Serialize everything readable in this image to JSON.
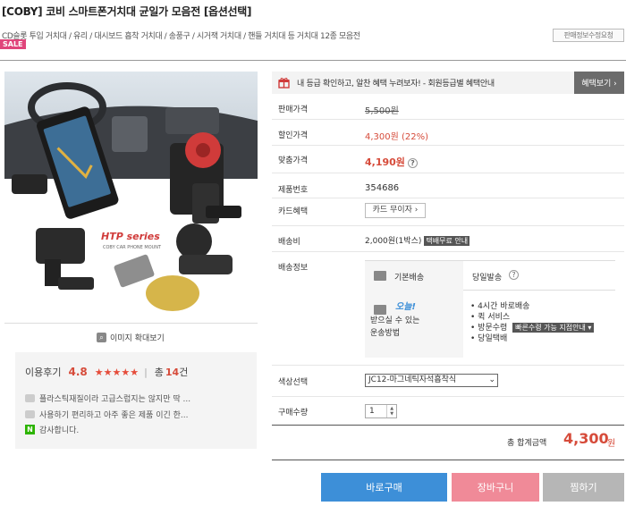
{
  "header": {
    "title": "[COBY] 코비 스마트폰거치대 균일가 모음전 [옵션선택]",
    "subtitle": "CD슬롯 투입 거치대 / 유리 / 대시보드 흡착 거치대 / 송풍구 / 시거잭 거치대 / 핸들 거치대 등 거치대 12종 모음전",
    "sale_badge": "SALE",
    "seller_info": "판매정보수정요청"
  },
  "image": {
    "brand_text": "HTP series",
    "brand_sub": "COBY CAR PHONE MOUNT",
    "zoom_label": "이미지 확대보기"
  },
  "reviews": {
    "label": "이용후기",
    "score": "4.8",
    "stars": "★★★★★",
    "count_label": "총",
    "count": "14",
    "count_unit": "건",
    "items": [
      "플라스틱재질이라 고급스럽지는 않지만 딱 ...",
      "사용하기 편리하고 아주 좋은 제품 이긴 한...",
      "감사합니다."
    ]
  },
  "promo": {
    "text": "내 등급 확인하고, 알찬 혜택 누려보자! - 회원등급별 혜택안내",
    "button": "혜택보기 ›"
  },
  "price": {
    "sale_label": "판매가격",
    "sale_value": "5,500원",
    "discount_label": "할인가격",
    "discount_value": "4,300원 (22%)",
    "custom_label": "맞춤가격",
    "custom_value": "4,190원",
    "product_no_label": "제품번호",
    "product_no": "354686",
    "card_label": "카드혜택",
    "card_button": "카드 무이자 ›",
    "ship_fee_label": "배송비",
    "ship_fee_value": "2,000원(1박스)",
    "free_ship_badge": "택배무료 안내",
    "ship_info_label": "배송정보"
  },
  "shipping": {
    "basic_label": "기본배송",
    "basic_value": "당일발송",
    "today_label": "오늘!",
    "today_sub1": "받으실 수 있는",
    "today_sub2": "운송방법",
    "methods": [
      "4시간 바로배송",
      "퀵 서비스",
      "방문수령",
      "당일택배"
    ],
    "pickup_badge": "빠른수령 가능 지점안내 ▾"
  },
  "options": {
    "color_label": "색상선택",
    "color_value": "JC12-마그네틱자석흡착식",
    "qty_label": "구매수량",
    "qty_value": "1"
  },
  "total": {
    "label": "총 합계금액",
    "value": "4,300",
    "unit": "원"
  },
  "buttons": {
    "buy": "바로구매",
    "cart": "장바구니",
    "wish": "찜하기"
  }
}
